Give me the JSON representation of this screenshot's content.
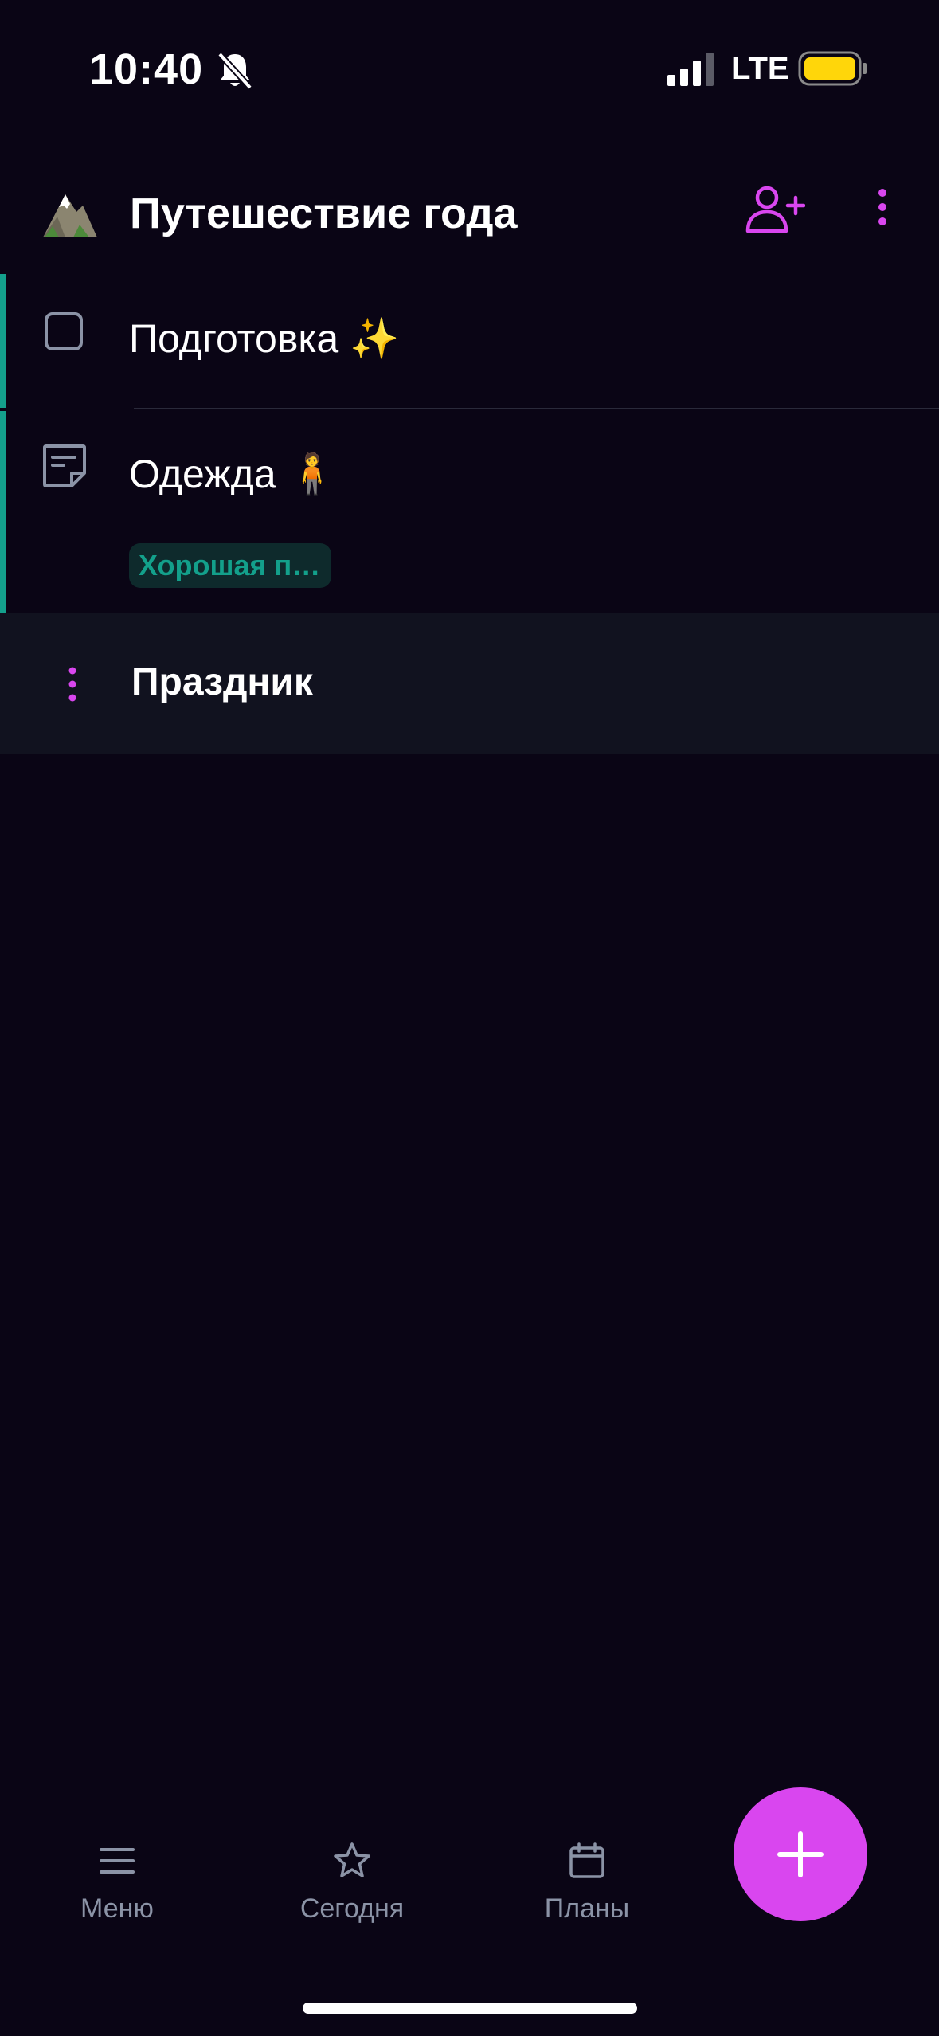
{
  "status_bar": {
    "time": "10:40",
    "network": "LTE",
    "battery_color": "#ffd60a"
  },
  "header": {
    "list_icon": "mountain-icon",
    "title": "Путешествие года",
    "share_icon": "add-user-icon",
    "more_icon": "more-vertical-icon"
  },
  "items": [
    {
      "type": "task",
      "label": "Подготовка ✨"
    },
    {
      "type": "note",
      "label": "Одежда 🧍",
      "tag": "Хорошая п…"
    }
  ],
  "section": {
    "title": "Праздник"
  },
  "nav": {
    "menu_label": "Меню",
    "today_label": "Сегодня",
    "plans_label": "Планы"
  },
  "colors": {
    "background": "#0a0515",
    "accent": "#d946ef",
    "list_marker": "#14a08c",
    "secondary_text": "#8b93a6",
    "section_bg": "#11121f"
  }
}
